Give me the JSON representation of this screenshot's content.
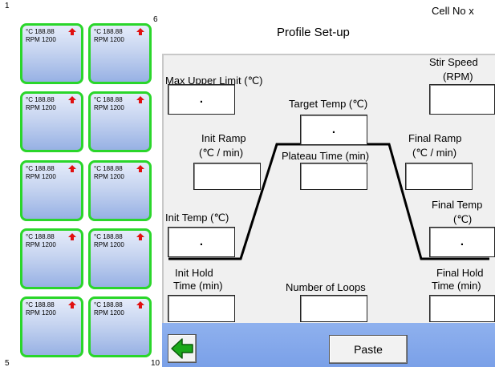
{
  "header": {
    "title": "Profile Set-up",
    "cell_no": "Cell No  x"
  },
  "cells": {
    "indices": {
      "top_left": "1",
      "top_right": "6",
      "bottom_left": "5",
      "bottom_right": "10"
    },
    "items": [
      {
        "temp": "°C 188.88",
        "rpm": "RPM 1200"
      },
      {
        "temp": "°C 188.88",
        "rpm": "RPM 1200"
      },
      {
        "temp": "°C 188.88",
        "rpm": "RPM 1200"
      },
      {
        "temp": "°C 188.88",
        "rpm": "RPM 1200"
      },
      {
        "temp": "°C 188.88",
        "rpm": "RPM 1200"
      },
      {
        "temp": "°C 188.88",
        "rpm": "RPM 1200"
      },
      {
        "temp": "°C 188.88",
        "rpm": "RPM 1200"
      },
      {
        "temp": "°C 188.88",
        "rpm": "RPM 1200"
      },
      {
        "temp": "°C 188.88",
        "rpm": "RPM 1200"
      },
      {
        "temp": "°C 188.88",
        "rpm": "RPM 1200"
      }
    ]
  },
  "fields": {
    "max_upper_limit": {
      "label": "Max Upper Limit (℃)",
      "value": "."
    },
    "stir_speed": {
      "label_line1": "Stir Speed",
      "label_line2": "(RPM)",
      "value": ""
    },
    "target_temp": {
      "label": "Target Temp (℃)",
      "value": "."
    },
    "init_ramp": {
      "label_line1": "Init Ramp",
      "label_line2": "(℃ / min)",
      "value": ""
    },
    "plateau_time": {
      "label": "Plateau Time  (min)",
      "value": ""
    },
    "final_ramp": {
      "label_line1": "Final Ramp",
      "label_line2": "(℃ / min)",
      "value": ""
    },
    "init_temp": {
      "label": "Init Temp (℃)",
      "value": "."
    },
    "final_temp": {
      "label_line1": "Final Temp",
      "label_line2": "(℃)",
      "value": "."
    },
    "init_hold_time": {
      "label_line1": "Init Hold",
      "label_line2": "Time (min)",
      "value": ""
    },
    "number_of_loops": {
      "label": "Number of Loops",
      "value": ""
    },
    "final_hold_time": {
      "label_line1": "Final Hold",
      "label_line2": "Time (min)",
      "value": ""
    }
  },
  "toolbar": {
    "back_icon": "green-left-arrow-icon",
    "paste_label": "Paste"
  },
  "colors": {
    "cell_border": "#2ad62a",
    "cell_arrow": "#e01010",
    "bottom_bar": "#7fa5ea",
    "back_arrow": "#1aa81a"
  }
}
